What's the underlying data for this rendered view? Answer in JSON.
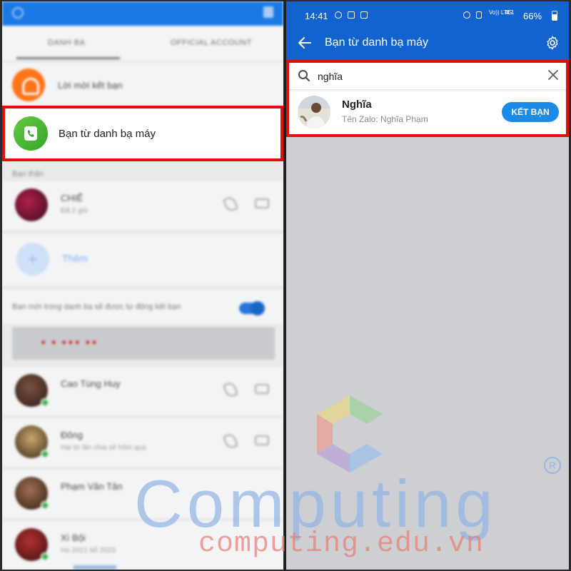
{
  "left_panel": {
    "tabs": [
      "DANH BẠ",
      "OFFICIAL ACCOUNT"
    ],
    "friend_requests_label": "Lời mời kết bạn",
    "highlight_label": "Bạn từ danh bạ máy",
    "section_heading": "Bạn thân",
    "contacts": [
      {
        "name": "CHIẾ",
        "sub": "Đã 2 giờ"
      },
      {
        "name": "Cao Tùng Huy",
        "sub": ""
      },
      {
        "name": "Đông",
        "sub": "Hai từ lần chia sẻ hôm qua"
      },
      {
        "name": "Phạm Văn Tân",
        "sub": ""
      },
      {
        "name": "Xì Bội",
        "sub": "Họ 2021 bổ 2023"
      }
    ],
    "invite_label": "Thêm",
    "toggle_label": "Bạn mới trong danh bạ sẽ được tự động kết bạn"
  },
  "status_bar": {
    "time": "14:41",
    "battery": "66%",
    "network": "Vo)) LTE1",
    "signal": "4G"
  },
  "app_bar": {
    "title": "Bạn từ danh bạ máy"
  },
  "search": {
    "value": "nghĩa",
    "placeholder": ""
  },
  "result": {
    "name": "Nghĩa",
    "subtitle": "Tên Zalo: Nghĩa Phạm",
    "action_label": "KẾT BẠN"
  },
  "watermark": {
    "brand": "Computing",
    "url": "computing.edu.vn",
    "registered": "R"
  },
  "colors": {
    "zalo_blue": "#1262cf",
    "highlight_red": "#e30d0d",
    "add_button": "#1b8ae8",
    "phone_green": "#4cb836"
  }
}
